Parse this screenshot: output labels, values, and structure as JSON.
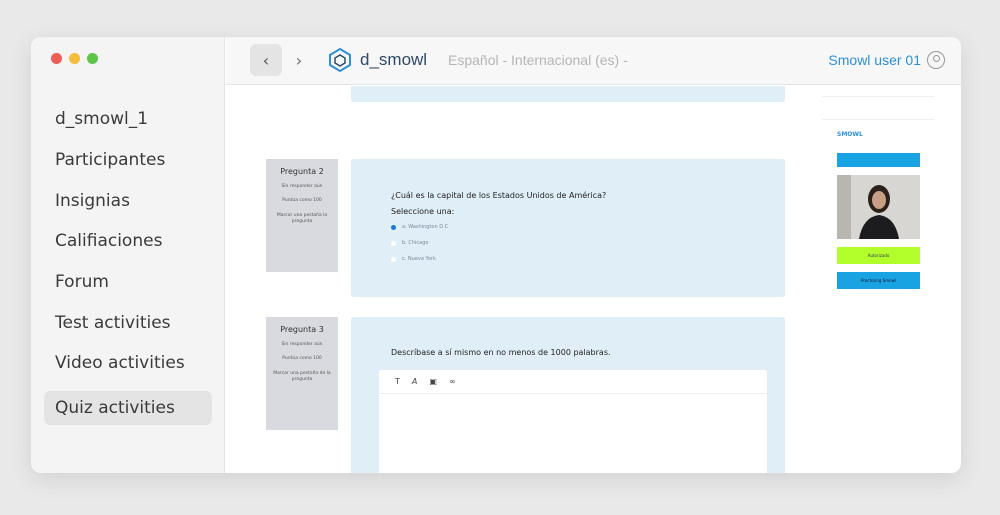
{
  "sidebar": {
    "items": [
      {
        "label": "d_smowl_1"
      },
      {
        "label": "Participantes"
      },
      {
        "label": "Insignias"
      },
      {
        "label": "Califiaciones"
      },
      {
        "label": "Forum"
      },
      {
        "label": "Test activities"
      },
      {
        "label": "Video activities"
      },
      {
        "label": "Quiz activities"
      }
    ],
    "active_index": 7
  },
  "topbar": {
    "brand": "d_smowl",
    "language": "Español - Internacional (es) -",
    "user": "Smowl user 01"
  },
  "questions": [
    {
      "number_label": "Pregunta 2",
      "status": "Sin responder aún",
      "points": "Puntúa como 100",
      "flag": "Marcar una pestaña la pregunta",
      "text": "¿Cuál es la capital de los Estados Unidos de América?",
      "prompt": "Seleccione una:",
      "options": [
        {
          "label": "a. Washington D.C",
          "selected": true
        },
        {
          "label": "b. Chicago",
          "selected": false
        },
        {
          "label": "c. Nueva York",
          "selected": false
        }
      ]
    },
    {
      "number_label": "Pregunta 3",
      "status": "Sin responder aún",
      "points": "Puntúa como 100",
      "flag": "Marcar una pestaña de la pregunta",
      "text": "Descríbase a sí mismo en no menos de 1000 palabras."
    }
  ],
  "proctor": {
    "logo": "SMOWL",
    "status_label": "Autorizado",
    "action_label": "Proctoring Smowl"
  },
  "colors": {
    "accent": "#2d8fd8",
    "card": "#dfeef7",
    "status_green": "#b2ff2c",
    "proctor_blue": "#1aa3e3"
  }
}
